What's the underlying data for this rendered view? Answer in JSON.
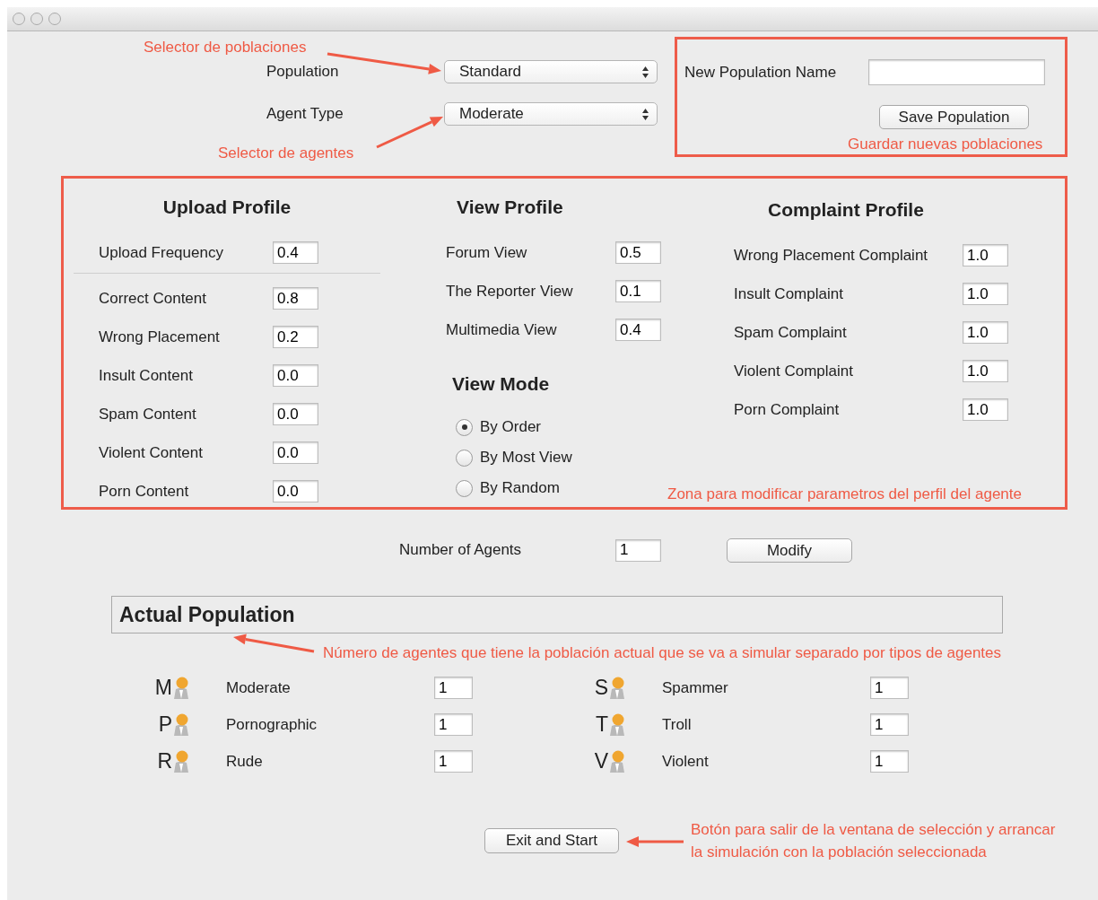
{
  "selectors": [
    {
      "label": "Population",
      "value": "Standard"
    },
    {
      "label": "Agent Type",
      "value": "Moderate"
    }
  ],
  "new_population": {
    "label": "New Population Name",
    "button": "Save Population"
  },
  "upload_profile": {
    "title": "Upload Profile",
    "frequency": {
      "label": "Upload Frequency",
      "value": "0.4"
    },
    "fields": [
      {
        "label": "Correct Content",
        "value": "0.8"
      },
      {
        "label": "Wrong Placement",
        "value": "0.2"
      },
      {
        "label": "Insult Content",
        "value": "0.0"
      },
      {
        "label": "Spam Content",
        "value": "0.0"
      },
      {
        "label": "Violent Content",
        "value": "0.0"
      },
      {
        "label": "Porn Content",
        "value": "0.0"
      }
    ]
  },
  "view_profile": {
    "title": "View Profile",
    "fields": [
      {
        "label": "Forum View",
        "value": "0.5"
      },
      {
        "label": "The Reporter View",
        "value": "0.1"
      },
      {
        "label": "Multimedia View",
        "value": "0.4"
      }
    ]
  },
  "view_mode": {
    "title": "View Mode",
    "options": [
      {
        "label": "By Order",
        "selected": true
      },
      {
        "label": "By Most View",
        "selected": false
      },
      {
        "label": "By Random",
        "selected": false
      }
    ]
  },
  "complaint_profile": {
    "title": "Complaint Profile",
    "fields": [
      {
        "label": "Wrong Placement Complaint",
        "value": "1.0"
      },
      {
        "label": "Insult Complaint",
        "value": "1.0"
      },
      {
        "label": "Spam Complaint",
        "value": "1.0"
      },
      {
        "label": "Violent Complaint",
        "value": "1.0"
      },
      {
        "label": "Porn Complaint",
        "value": "1.0"
      }
    ]
  },
  "number_of_agents": {
    "label": "Number of Agents",
    "value": "1",
    "button": "Modify"
  },
  "actual_population": {
    "title": "Actual Population",
    "agents": [
      {
        "letter": "M",
        "name": "Moderate",
        "count": "1"
      },
      {
        "letter": "S",
        "name": "Spammer",
        "count": "1"
      },
      {
        "letter": "P",
        "name": "Pornographic",
        "count": "1"
      },
      {
        "letter": "T",
        "name": "Troll",
        "count": "1"
      },
      {
        "letter": "R",
        "name": "Rude",
        "count": "1"
      },
      {
        "letter": "V",
        "name": "Violent",
        "count": "1"
      }
    ]
  },
  "exit_button": "Exit and Start",
  "annotations": [
    {
      "text": "Selector de poblaciones"
    },
    {
      "text": "Selector de agentes"
    },
    {
      "text": "Guardar nuevas poblaciones"
    },
    {
      "text": "Zona para modificar parametros del perfil del agente"
    },
    {
      "text": "Número de agentes que tiene la población actual que se va a simular separado por tipos de agentes"
    },
    {
      "text": "Botón para salir de la ventana de selección y arrancar\nla simulación con la población seleccionada"
    }
  ]
}
